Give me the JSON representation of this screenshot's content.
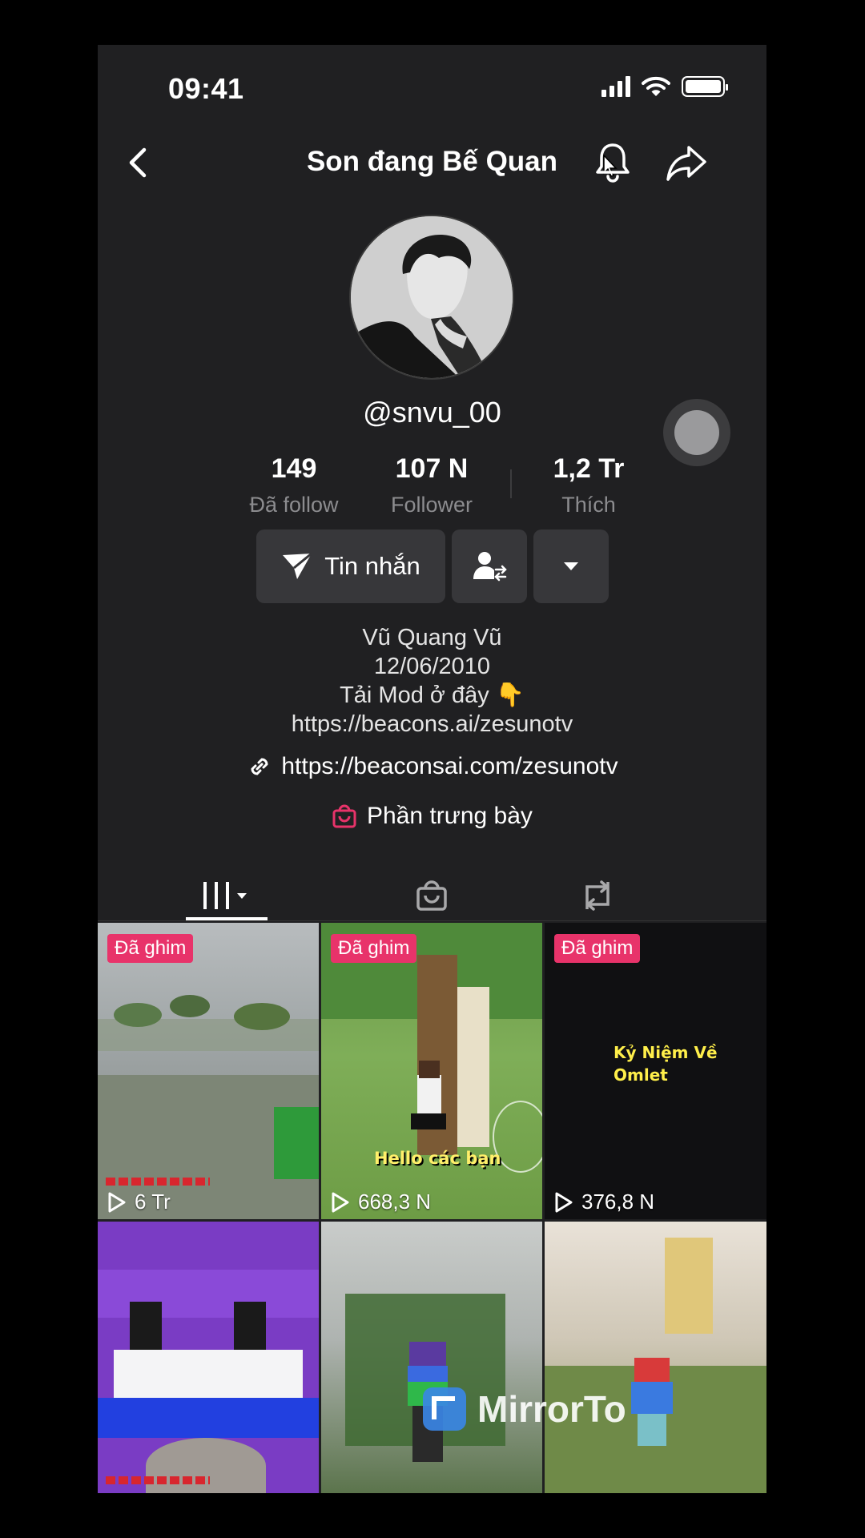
{
  "status_bar": {
    "time": "09:41"
  },
  "header": {
    "title": "Son đang Bế Quan"
  },
  "profile": {
    "username": "@snvu_00",
    "stats": [
      {
        "value": "149",
        "label": "Đã follow"
      },
      {
        "value": "107 N",
        "label": "Follower"
      },
      {
        "value": "1,2 Tr",
        "label": "Thích"
      }
    ],
    "message_button_label": "Tin nhắn",
    "bio_lines": [
      "Vũ Quang Vũ",
      "12/06/2010",
      "Tải Mod ở đây 👇",
      "https://beacons.ai/zesunotv"
    ],
    "link": "https://beaconsai.com/zesunotv",
    "showcase_label": "Phần trưng bày"
  },
  "videos": [
    {
      "pinned": "Đã ghim",
      "views": "6 Tr"
    },
    {
      "pinned": "Đã ghim",
      "views": "668,3 N",
      "caption": "Hello các bạn"
    },
    {
      "pinned": "Đã ghim",
      "views": "376,8 N",
      "title_line1": "Kỷ Niệm Về",
      "title_line2": "Omlet"
    },
    {
      "views": ""
    },
    {
      "views": ""
    },
    {
      "views": ""
    }
  ],
  "watermark": "MirrorTo",
  "colors": {
    "accent": "#e8336a",
    "background": "#202022",
    "button": "#37373a"
  }
}
